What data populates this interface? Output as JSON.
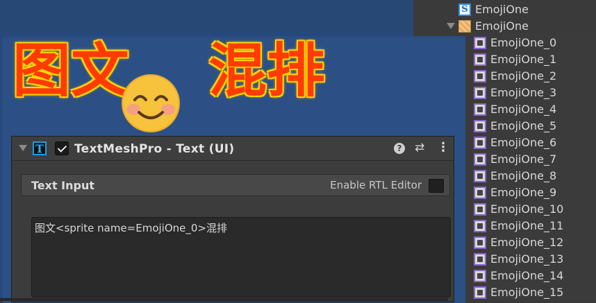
{
  "scene": {
    "title_part1": "图文",
    "title_part2": "混排",
    "emoji": "smiling-face-emoji"
  },
  "component": {
    "title": "TextMeshPro - Text (UI)",
    "icon_letter": "T",
    "enabled": true,
    "text_input_label": "Text Input",
    "rtl_label": "Enable RTL Editor",
    "rtl_enabled": false,
    "text_value": "图文<sprite name=EmojiOne_0>混排"
  },
  "hierarchy": {
    "script_asset": "EmojiOne",
    "atlas": "EmojiOne",
    "sprites": [
      "EmojiOne_0",
      "EmojiOne_1",
      "EmojiOne_2",
      "EmojiOne_3",
      "EmojiOne_4",
      "EmojiOne_5",
      "EmojiOne_6",
      "EmojiOne_7",
      "EmojiOne_8",
      "EmojiOne_9",
      "EmojiOne_10",
      "EmojiOne_11",
      "EmojiOne_12",
      "EmojiOne_13",
      "EmojiOne_14",
      "EmojiOne_15"
    ]
  },
  "colors": {
    "scene_bg": "#27487a",
    "title_fill": "#ff3b00",
    "title_glow": "#ffe000"
  }
}
